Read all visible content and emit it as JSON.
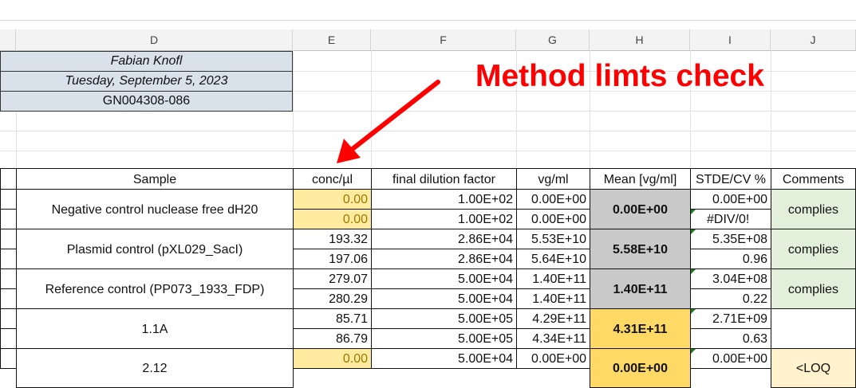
{
  "columns": [
    "D",
    "E",
    "F",
    "G",
    "H",
    "I",
    "J"
  ],
  "info": {
    "name": "Fabian Knofl",
    "date": "Tuesday, September 5, 2023",
    "code": "GN004308-086"
  },
  "annotation": {
    "title": "Method limts check",
    "color": "#ff0000"
  },
  "table": {
    "headers": {
      "sample": "Sample",
      "conc": "conc/µl",
      "dilution": "final dilution factor",
      "vg": "vg/ml",
      "mean": "Mean [vg/ml]",
      "stde": "STDE/CV %",
      "comments": "Comments"
    },
    "groups": [
      {
        "sample": "Negative control nuclease free dH20",
        "mean": "0.00E+00",
        "comment": "complies",
        "rows": [
          {
            "conc": "0.00",
            "dilution": "1.00E+02",
            "vg": "0.00E+00",
            "stde": "0.00E+00"
          },
          {
            "conc": "0.00",
            "dilution": "1.00E+02",
            "vg": "0.00E+00",
            "stde": "#DIV/0!"
          }
        ]
      },
      {
        "sample": "Plasmid control (pXL029_SacI)",
        "mean": "5.58E+10",
        "comment": "complies",
        "rows": [
          {
            "conc": "193.32",
            "dilution": "2.86E+04",
            "vg": "5.53E+10",
            "stde": "5.35E+08"
          },
          {
            "conc": "197.06",
            "dilution": "2.86E+04",
            "vg": "5.64E+10",
            "stde": "0.96"
          }
        ]
      },
      {
        "sample": "Reference control (PP073_1933_FDP)",
        "mean": "1.40E+11",
        "comment": "complies",
        "rows": [
          {
            "conc": "279.07",
            "dilution": "5.00E+04",
            "vg": "1.40E+11",
            "stde": "3.04E+08"
          },
          {
            "conc": "280.29",
            "dilution": "5.00E+04",
            "vg": "1.40E+11",
            "stde": "0.22"
          }
        ]
      },
      {
        "sample": "1.1A",
        "mean": "4.31E+11",
        "comment": "",
        "rows": [
          {
            "conc": "85.71",
            "dilution": "5.00E+05",
            "vg": "4.29E+11",
            "stde": "2.71E+09"
          },
          {
            "conc": "86.79",
            "dilution": "5.00E+05",
            "vg": "4.34E+11",
            "stde": "0.63"
          }
        ]
      },
      {
        "sample": "2.12",
        "mean": "0.00E+00",
        "comment": "<LOQ",
        "rows": [
          {
            "conc": "0.00",
            "dilution": "5.00E+04",
            "vg": "0.00E+00",
            "stde": "0.00E+00"
          }
        ]
      }
    ]
  },
  "colors": {
    "yellow_fill": "#ffeba0",
    "grey_fill": "#c9c9c9",
    "orange_fill": "#ffd966",
    "green_fill": "#e2efda",
    "cream_fill": "#fff2cc",
    "info_fill": "#d9e1ea"
  }
}
